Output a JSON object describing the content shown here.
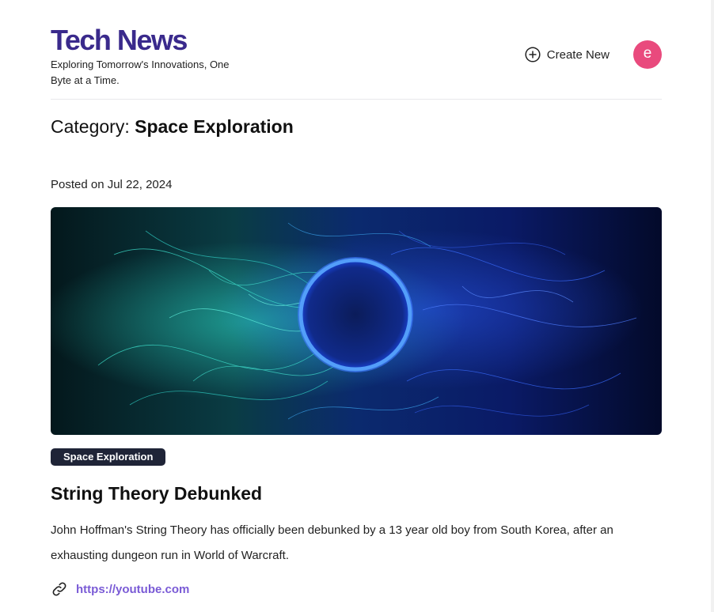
{
  "header": {
    "site_title": "Tech News",
    "tagline": "Exploring Tomorrow's Innovations, One Byte at a Time.",
    "create_new_label": "Create New",
    "create_new_icon": "plus-circle-icon",
    "avatar_initial": "e",
    "avatar_color": "#e94a7d"
  },
  "category": {
    "prefix": "Category:",
    "name": "Space Exploration"
  },
  "post": {
    "posted_on": "Posted on Jul 22, 2024",
    "image_icon": "space-ring-image",
    "tag": "Space Exploration",
    "title": "String Theory Debunked",
    "excerpt": "John Hoffman's String Theory has officially been debunked by a 13 year old boy from South Korea, after an exhausting dungeon run in World of Warcraft.",
    "link_icon": "link-icon",
    "link_text": "https://youtube.com"
  },
  "colors": {
    "brand": "#3a2a8c",
    "tag_bg": "#1f2437",
    "link": "#7a5bd6"
  }
}
